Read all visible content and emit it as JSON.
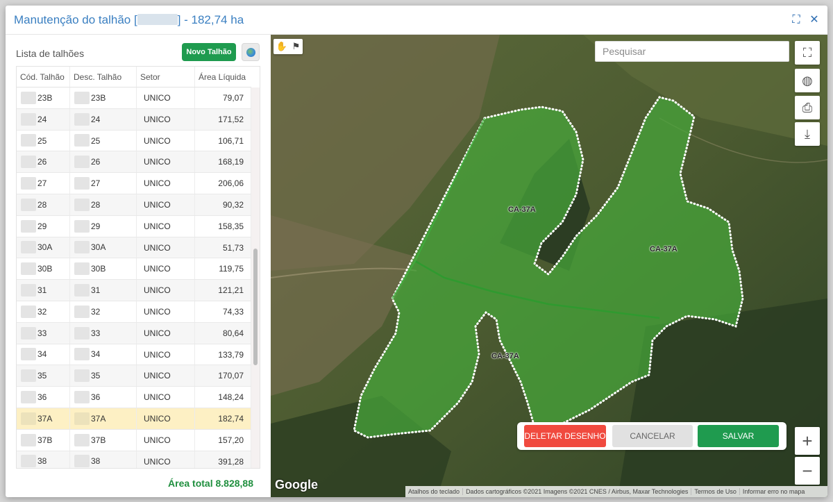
{
  "modal": {
    "title_prefix": "Manutenção do talhão [",
    "title_suffix": "] - 182,74 ha"
  },
  "list": {
    "title": "Lista de talhões",
    "new_button": "Novo Talhão",
    "columns": [
      "Cód. Talhão",
      "Desc. Talhão",
      "Setor",
      "Área Líquida"
    ],
    "rows": [
      {
        "code": "23B",
        "desc": "23B",
        "sector": "UNICO",
        "area": "79,07"
      },
      {
        "code": "24",
        "desc": "24",
        "sector": "UNICO",
        "area": "171,52"
      },
      {
        "code": "25",
        "desc": "25",
        "sector": "UNICO",
        "area": "106,71"
      },
      {
        "code": "26",
        "desc": "26",
        "sector": "UNICO",
        "area": "168,19"
      },
      {
        "code": "27",
        "desc": "27",
        "sector": "UNICO",
        "area": "206,06"
      },
      {
        "code": "28",
        "desc": "28",
        "sector": "UNICO",
        "area": "90,32"
      },
      {
        "code": "29",
        "desc": "29",
        "sector": "UNICO",
        "area": "158,35"
      },
      {
        "code": "30A",
        "desc": "30A",
        "sector": "UNICO",
        "area": "51,73"
      },
      {
        "code": "30B",
        "desc": "30B",
        "sector": "UNICO",
        "area": "119,75"
      },
      {
        "code": "31",
        "desc": "31",
        "sector": "UNICO",
        "area": "121,21"
      },
      {
        "code": "32",
        "desc": "32",
        "sector": "UNICO",
        "area": "74,33"
      },
      {
        "code": "33",
        "desc": "33",
        "sector": "UNICO",
        "area": "80,64"
      },
      {
        "code": "34",
        "desc": "34",
        "sector": "UNICO",
        "area": "133,79"
      },
      {
        "code": "35",
        "desc": "35",
        "sector": "UNICO",
        "area": "170,07"
      },
      {
        "code": "36",
        "desc": "36",
        "sector": "UNICO",
        "area": "148,24"
      },
      {
        "code": "37A",
        "desc": "37A",
        "sector": "UNICO",
        "area": "182,74",
        "selected": true
      },
      {
        "code": "37B",
        "desc": "37B",
        "sector": "UNICO",
        "area": "157,20"
      },
      {
        "code": "38",
        "desc": "38",
        "sector": "UNICO",
        "area": "391,28"
      }
    ],
    "total_label": "Área total 8.828,88"
  },
  "map": {
    "search_placeholder": "Pesquisar",
    "plot_label": "CA-37A",
    "delete_button": "DELETAR DESENHO",
    "cancel_button": "CANCELAR",
    "save_button": "SALVAR",
    "zoom_in": "+",
    "zoom_out": "−",
    "google_logo": "Google",
    "attribution": [
      "Atalhos do teclado",
      "Dados cartográficos ©2021 Imagens ©2021 CNES / Airbus, Maxar Technologies",
      "Termos de Uso",
      "Informar erro no mapa"
    ]
  },
  "colors": {
    "accent": "#3a7fc1",
    "primary_green": "#1f9b4f",
    "danger": "#f04a3f",
    "selected_row": "#fdf0c4"
  },
  "icons": {
    "expand": "expand-icon",
    "close": "close-icon",
    "fullscreen": "fullscreen-icon",
    "globe": "globe-icon",
    "print": "print-icon",
    "download": "download-file-icon",
    "hand": "hand-pan-icon",
    "draw": "draw-shape-icon"
  }
}
